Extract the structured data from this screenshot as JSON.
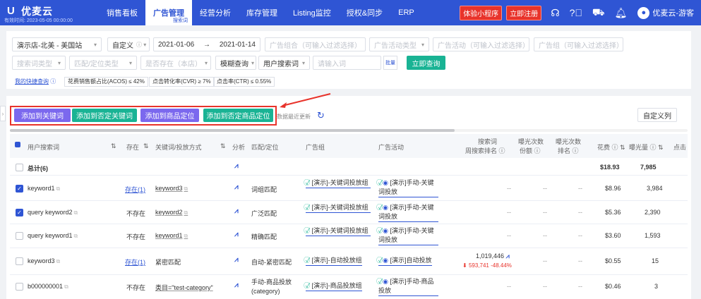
{
  "nav": {
    "logo_mark": "U",
    "logo_text": "优麦云",
    "logo_sub": "有效时间: 2023-05-05 00:00:00",
    "items": [
      {
        "label": "销售看板"
      },
      {
        "label": "广告管理",
        "sub": "搜索词"
      },
      {
        "label": "经营分析"
      },
      {
        "label": "库存管理"
      },
      {
        "label": "Listing监控"
      },
      {
        "label": "授权&同步"
      },
      {
        "label": "ERP"
      }
    ],
    "btn_miniprogram": "体验小程序",
    "btn_register": "立即注册",
    "username": "优麦云-游客"
  },
  "filters": {
    "store": "演示店-北美 - 美国站",
    "date_type": "自定义",
    "date_start": "2021-01-06",
    "date_sep": "→",
    "date_end": "2021-01-14",
    "portfolio_ph": "广告组合（可输入过滤选择）",
    "ad_type_ph": "广告活动类型",
    "campaign_ph": "广告活动（可输入过滤选择）",
    "adgroup_ph": "广告组（可输入过滤选择）",
    "search_type_ph": "搜索词类型",
    "match_type_ph": "匹配/定位类型",
    "exists_ph": "是否存在（本店）",
    "fuzzy": "模糊查询",
    "field": "用户搜索词",
    "input_ph": "请输入词",
    "query_btn": "立即查询",
    "qicon_text": "批量",
    "quick_query": "我的快捷查询",
    "chips": [
      "花费销售额占比(ACOS) ≤ 42%",
      "点击转化率(CVR) ≥ 7%",
      "点击率(CTR) ≤ 0.55%"
    ]
  },
  "actions": {
    "add_keyword": "添加到关键词",
    "add_neg_keyword": "添加到否定关键词",
    "add_product": "添加到商品定位",
    "add_neg_product": "添加到否定商品定位",
    "note": "数据最近更新",
    "custom_cols": "自定义列"
  },
  "table": {
    "headers": {
      "search_term": "用户搜索词",
      "exists": "存在",
      "keyword": "关键词/投放方式",
      "analysis": "分析",
      "match": "匹配/定位",
      "adgroup": "广告组",
      "campaign": "广告活动",
      "rank1": "搜索词",
      "rank2": "周搜索排名 ⓘ",
      "impr1": "曝光次数",
      "impr2": "份额 ⓘ",
      "click1": "曝光次数",
      "click2": "排名 ⓘ",
      "spend": "花费",
      "imprs": "曝光量",
      "more": "点击"
    },
    "total": {
      "label": "总计(6)",
      "spend": "$18.93",
      "imprs": "7,985"
    },
    "rows": [
      {
        "checked": true,
        "term": "keyword1",
        "exists": "存在(1)",
        "exists_link": true,
        "kw": "keyword3",
        "match": "词组匹配",
        "adgroup": "[演示]-关键词投放组",
        "campaign": "[演示]手动-关键词投放",
        "rank": "--",
        "impr": "--",
        "click": "--",
        "spend": "$8.96",
        "imprs": "3,984"
      },
      {
        "checked": true,
        "term": "query keyword2",
        "exists": "不存在",
        "exists_link": false,
        "kw": "keyword2",
        "match": "广泛匹配",
        "adgroup": "[演示]-关键词投放组",
        "campaign": "[演示]手动-关键词投放",
        "rank": "--",
        "impr": "--",
        "click": "--",
        "spend": "$5.36",
        "imprs": "2,390"
      },
      {
        "checked": false,
        "term": "query keyword1",
        "exists": "不存在",
        "exists_link": false,
        "kw": "keyword1",
        "match": "精确匹配",
        "adgroup": "[演示]-关键词投放组",
        "campaign": "[演示]手动-关键词投放",
        "rank": "--",
        "impr": "--",
        "click": "--",
        "spend": "$3.60",
        "imprs": "1,593"
      },
      {
        "checked": false,
        "term": "keyword3",
        "exists": "存在(1)",
        "exists_link": true,
        "kw": "紧密匹配",
        "match": "自动-紧密匹配",
        "adgroup": "[演示]-自动投放组",
        "campaign": "[演示]自动投放",
        "rank": "1,019,446",
        "rank_delta": "593,741  -48.44%",
        "impr": "--",
        "click": "--",
        "spend": "$0.55",
        "imprs": "15"
      },
      {
        "checked": false,
        "term": "b000000001",
        "exists": "不存在",
        "exists_link": false,
        "kw": "类目=\"test-category\"",
        "match": "手动-商品投放(category)",
        "adgroup": "[演示]-商品投放组",
        "campaign": "[演示]手动-商品投放",
        "rank": "--",
        "impr": "--",
        "click": "--",
        "spend": "$0.46",
        "imprs": "3"
      }
    ]
  },
  "colors": {
    "brand": "#2f55d4",
    "green": "#19b394",
    "purple": "#7b68ee",
    "red": "#e8332b"
  }
}
